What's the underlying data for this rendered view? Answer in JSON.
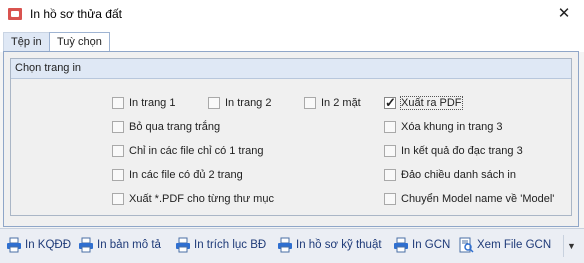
{
  "window": {
    "title": "In hồ sơ thửa đất",
    "close_glyph": "✕"
  },
  "tabs": [
    {
      "label": "Tệp in",
      "selected": false
    },
    {
      "label": "Tuỳ chọn",
      "selected": true
    }
  ],
  "group": {
    "title": "Chọn trang in",
    "options": [
      {
        "label": "In trang 1",
        "checked": false
      },
      {
        "label": "In trang 2",
        "checked": false
      },
      {
        "label": "In 2 mặt",
        "checked": false
      },
      {
        "label": "Xuất ra PDF",
        "checked": true
      },
      {
        "label": "Bỏ qua trang trắng",
        "checked": false
      },
      {
        "label": "Xóa khung in trang 3",
        "checked": false
      },
      {
        "label": "Chỉ in các file chỉ có 1 trang",
        "checked": false
      },
      {
        "label": "In kết quả đo đạc trang 3",
        "checked": false
      },
      {
        "label": "In các file có đủ 2 trang",
        "checked": false
      },
      {
        "label": "Đảo chiều danh sách in",
        "checked": false
      },
      {
        "label": "Xuất *.PDF cho từng thư mục",
        "checked": false
      },
      {
        "label": "Chuyển Model name về 'Model'",
        "checked": false
      }
    ]
  },
  "toolbar": {
    "buttons": [
      {
        "label": "In KQĐĐ",
        "icon": "printer-icon"
      },
      {
        "label": "In bản mô tả",
        "icon": "printer-icon"
      },
      {
        "label": "In trích lục BĐ",
        "icon": "printer-icon"
      },
      {
        "label": "In hồ sơ kỹ thuật",
        "icon": "printer-icon"
      },
      {
        "label": "In GCN",
        "icon": "printer-icon"
      },
      {
        "label": "Xem File GCN",
        "icon": "document-view-icon"
      }
    ],
    "overflow_glyph": "▼"
  },
  "colors": {
    "accent": "#1e3a78",
    "header_bg": "#dfe8f5",
    "border": "#8fa6c8"
  }
}
